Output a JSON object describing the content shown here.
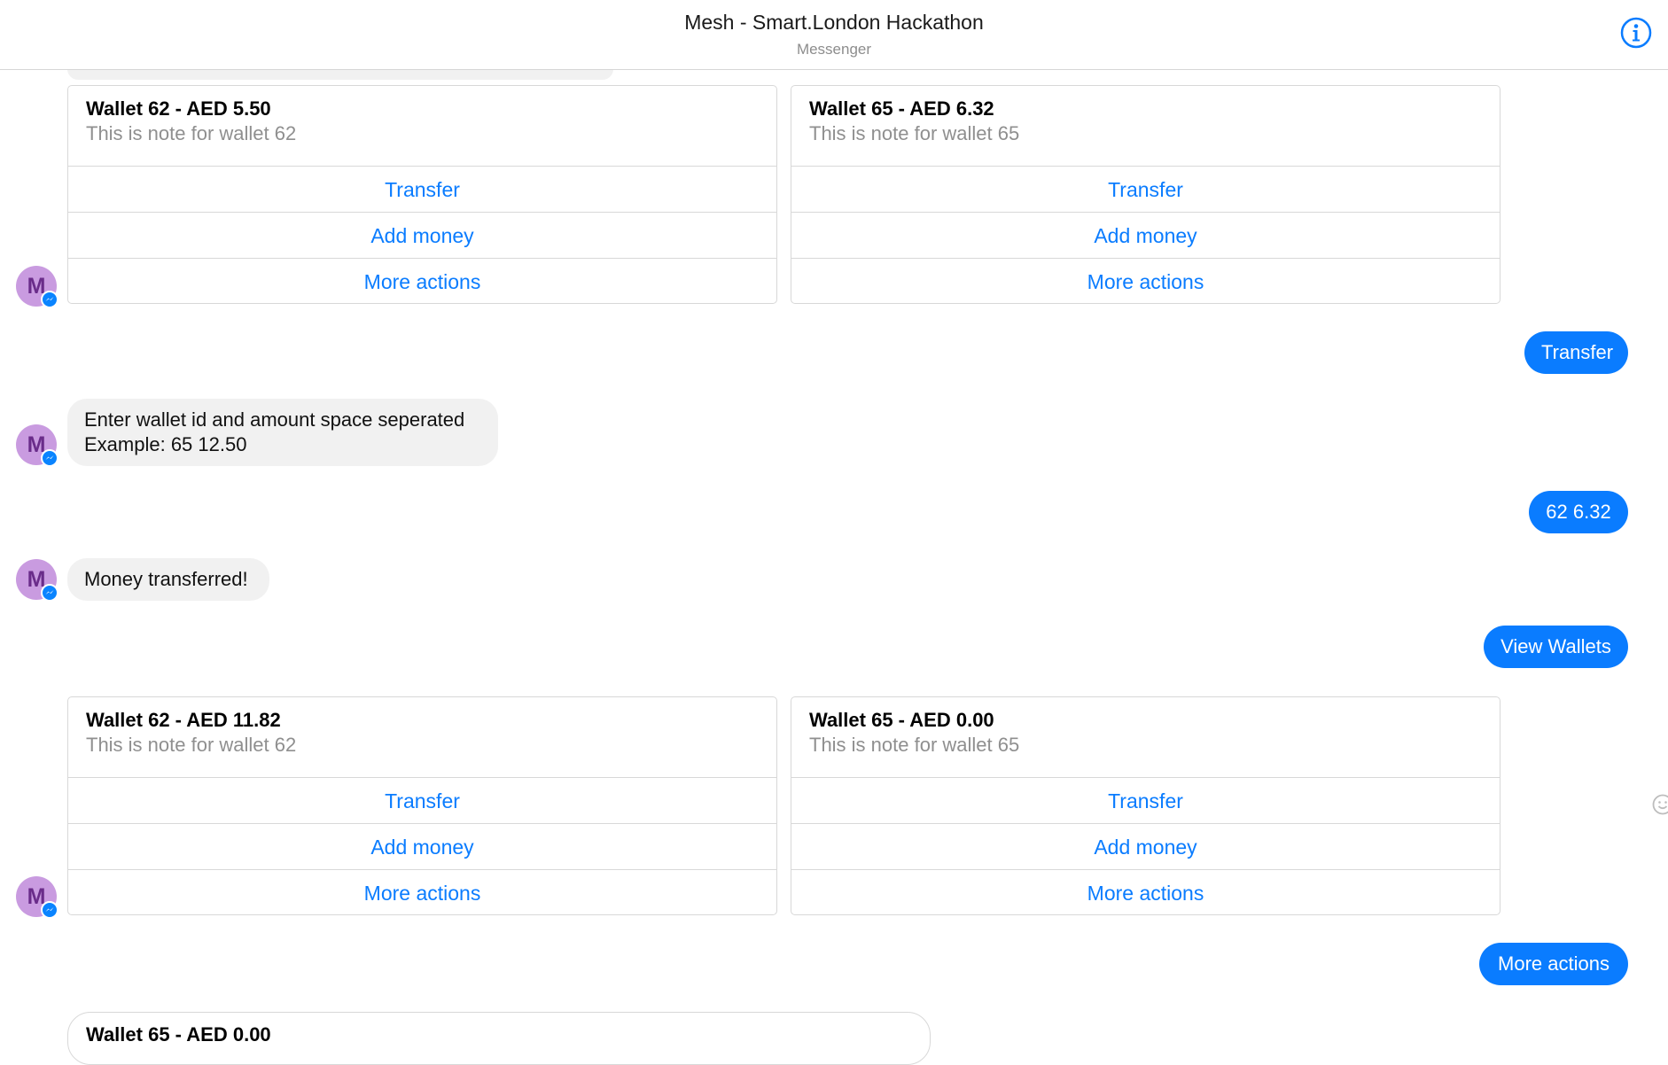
{
  "header": {
    "title": "Mesh - Smart.London Hackathon",
    "subtitle": "Messenger"
  },
  "avatar_letter": "M",
  "colors": {
    "accent": "#0a7cff",
    "avatar_bg": "#c99be0",
    "avatar_text": "#6a2c8a",
    "incoming_bubble": "#f1f1f1"
  },
  "card_group_1": {
    "cards": [
      {
        "title": "Wallet 62 - AED 5.50",
        "note": "This is note for wallet 62",
        "buttons": [
          "Transfer",
          "Add money",
          "More actions"
        ]
      },
      {
        "title": "Wallet 65 - AED 6.32",
        "note": "This is note for wallet 65",
        "buttons": [
          "Transfer",
          "Add money",
          "More actions"
        ]
      }
    ]
  },
  "messages": {
    "out_transfer": "Transfer",
    "in_instructions_line1": "Enter wallet id and amount space seperated",
    "in_instructions_line2": "Example: 65 12.50",
    "out_amount": "62 6.32",
    "in_confirm": "Money transferred!",
    "out_view_wallets": "View Wallets",
    "out_more_actions": "More actions"
  },
  "card_group_2": {
    "cards": [
      {
        "title": "Wallet 62 - AED 11.82",
        "note": "This is note for wallet 62",
        "buttons": [
          "Transfer",
          "Add money",
          "More actions"
        ]
      },
      {
        "title": "Wallet 65 - AED 0.00",
        "note": "This is note for wallet 65",
        "buttons": [
          "Transfer",
          "Add money",
          "More actions"
        ]
      }
    ]
  },
  "partial_card": {
    "title": "Wallet 65 - AED 0.00"
  },
  "icons": [
    "info-icon",
    "messenger-badge-icon",
    "smiley-icon"
  ]
}
